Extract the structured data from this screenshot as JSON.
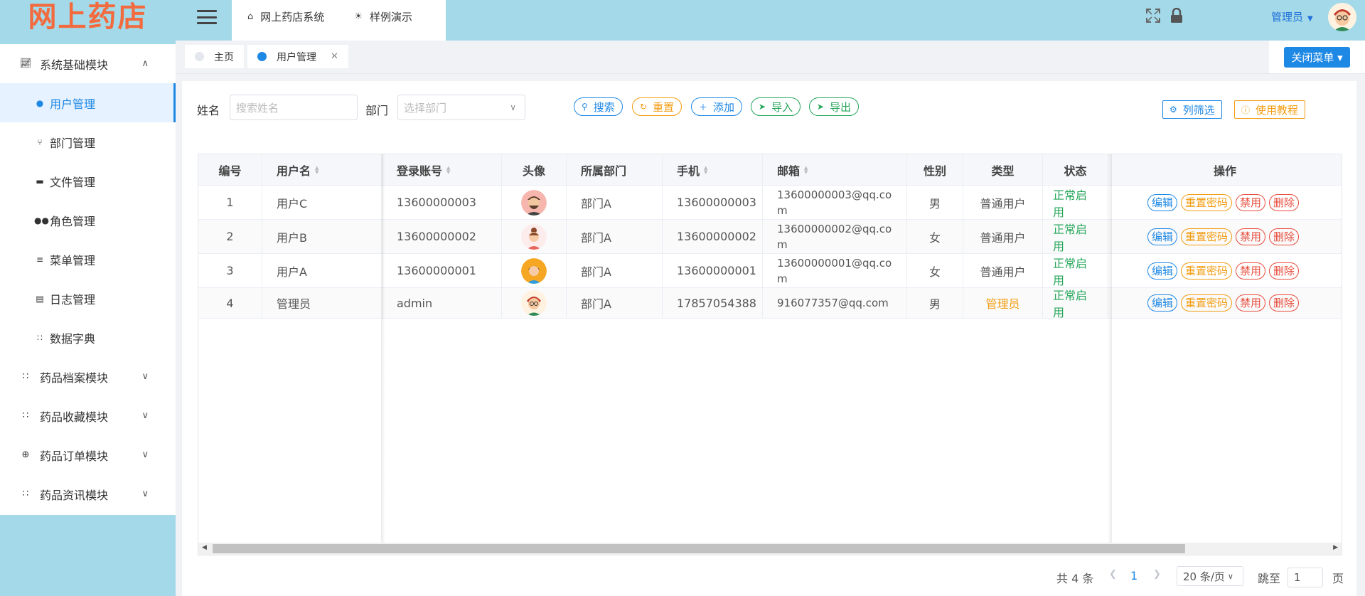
{
  "app": {
    "logo": "网上药店"
  },
  "sidebar": {
    "groups": [
      {
        "label": "系统基础模块",
        "icon": "chart-icon",
        "expanded": true,
        "items": [
          {
            "label": "用户管理",
            "icon": "user-icon",
            "active": true
          },
          {
            "label": "部门管理",
            "icon": "branch-icon"
          },
          {
            "label": "文件管理",
            "icon": "folder-icon"
          },
          {
            "label": "角色管理",
            "icon": "users-icon"
          },
          {
            "label": "菜单管理",
            "icon": "list-icon"
          },
          {
            "label": "日志管理",
            "icon": "log-icon"
          },
          {
            "label": "数据字典",
            "icon": "grid-icon"
          }
        ]
      },
      {
        "label": "药品档案模块",
        "icon": "grid-icon"
      },
      {
        "label": "药品收藏模块",
        "icon": "grid-icon"
      },
      {
        "label": "药品订单模块",
        "icon": "globe-icon"
      },
      {
        "label": "药品资讯模块",
        "icon": "grid-icon"
      }
    ]
  },
  "header": {
    "tabs": [
      {
        "label": "网上药店系统",
        "icon": "home-icon"
      },
      {
        "label": "样例演示",
        "icon": "bulb-icon"
      }
    ],
    "user": "管理员"
  },
  "tagbar": {
    "tags": [
      {
        "label": "主页",
        "active": false
      },
      {
        "label": "用户管理",
        "active": true,
        "closable": true
      }
    ],
    "close_menu": "关闭菜单"
  },
  "filters": {
    "name_label": "姓名",
    "name_placeholder": "搜索姓名",
    "dept_label": "部门",
    "dept_placeholder": "选择部门",
    "buttons": {
      "search": "搜索",
      "reset": "重置",
      "add": "添加",
      "import": "导入",
      "export": "导出",
      "columns": "列筛选",
      "tutorial": "使用教程"
    }
  },
  "table": {
    "columns": [
      "编号",
      "用户名",
      "登录账号",
      "头像",
      "所属部门",
      "手机",
      "邮箱",
      "性别",
      "类型",
      "状态",
      "操作"
    ],
    "rows": [
      {
        "id": "1",
        "username": "用户C",
        "account": "13600000003",
        "dept": "部门A",
        "phone": "13600000003",
        "email": "13600000003@qq.com",
        "gender": "男",
        "type": "普通用户",
        "status": "正常启用"
      },
      {
        "id": "2",
        "username": "用户B",
        "account": "13600000002",
        "dept": "部门A",
        "phone": "13600000002",
        "email": "13600000002@qq.com",
        "gender": "女",
        "type": "普通用户",
        "status": "正常启用"
      },
      {
        "id": "3",
        "username": "用户A",
        "account": "13600000001",
        "dept": "部门A",
        "phone": "13600000001",
        "email": "13600000001@qq.com",
        "gender": "女",
        "type": "普通用户",
        "status": "正常启用"
      },
      {
        "id": "4",
        "username": "管理员",
        "account": "admin",
        "dept": "部门A",
        "phone": "17857054388",
        "email": "916077357@qq.com",
        "gender": "男",
        "type": "管理员",
        "status": "正常启用"
      }
    ],
    "actions": {
      "edit": "编辑",
      "reset_pwd": "重置密码",
      "disable": "禁用",
      "delete": "删除"
    }
  },
  "pagination": {
    "total": "共 4 条",
    "current": "1",
    "page_size": "20 条/页",
    "jump_label": "跳至",
    "jump_value": "1",
    "page_suffix": "页"
  },
  "colors": {
    "accent": "#1e88e5",
    "sidebar_bg": "#a3d9e8",
    "logo": "#f26a3d",
    "success": "#26a65b",
    "warning": "#f39c12",
    "danger": "#e74c3c"
  }
}
